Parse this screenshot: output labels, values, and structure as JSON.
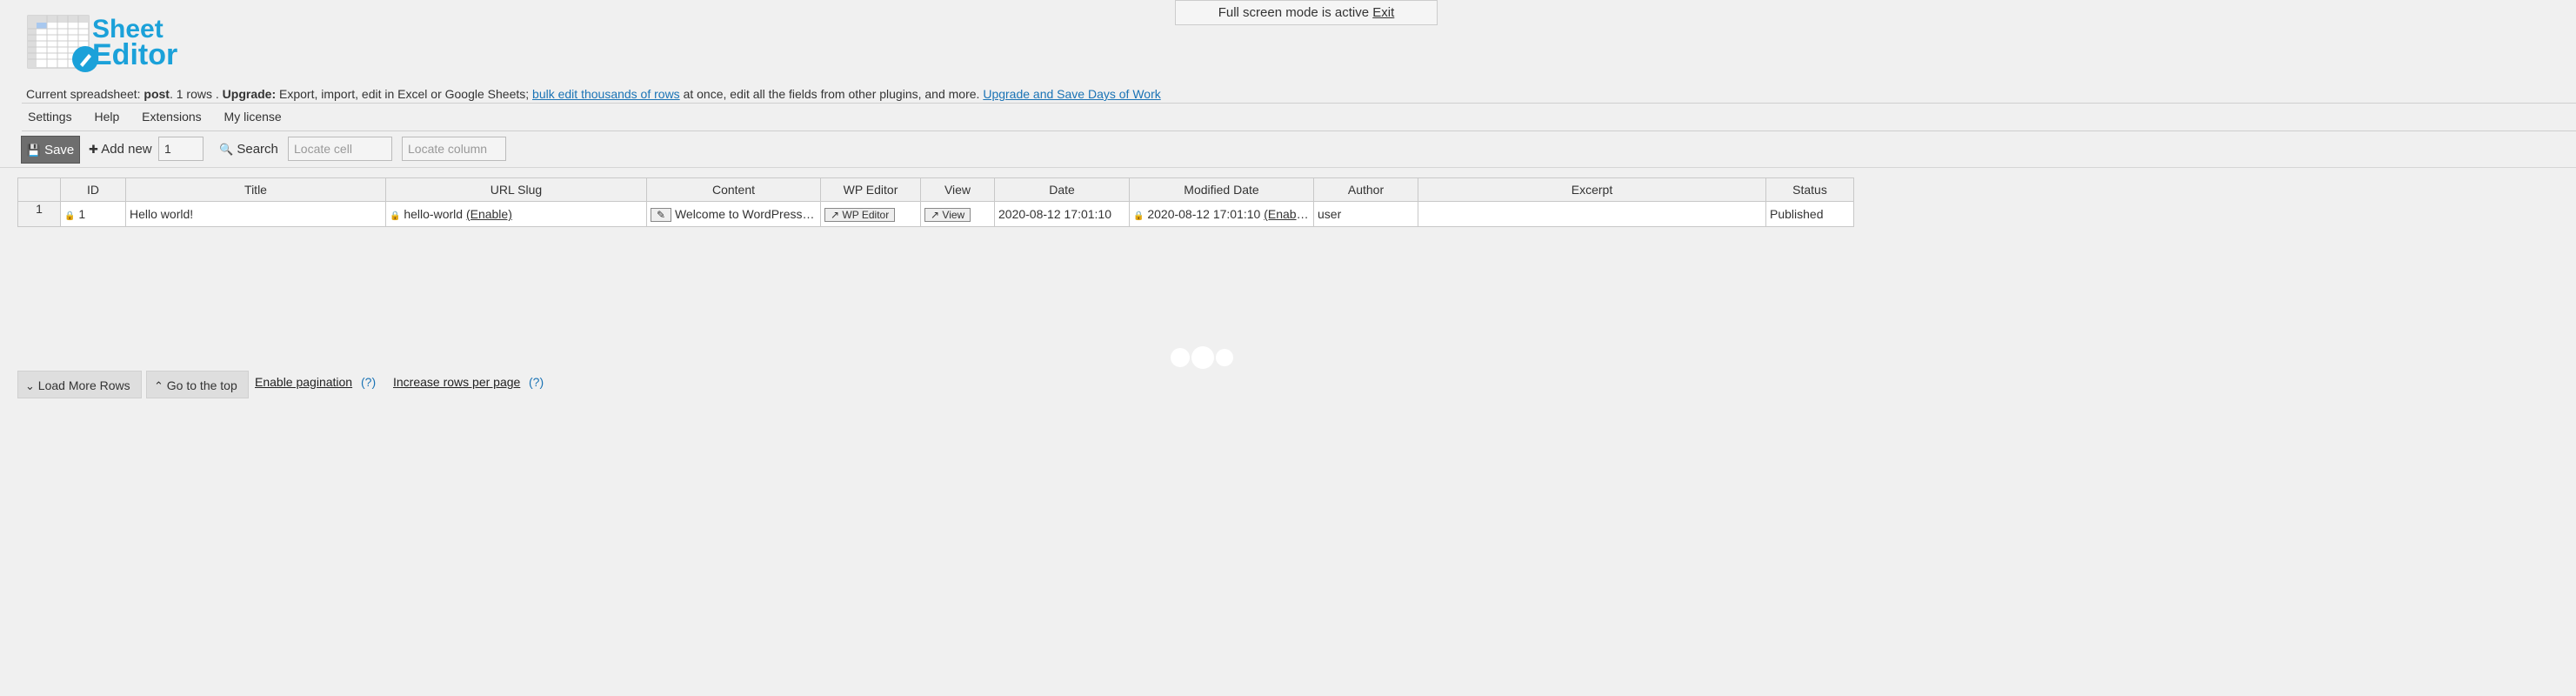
{
  "fullscreen": {
    "text": "Full screen mode is active",
    "exit": "Exit"
  },
  "logo": {
    "line1": "Sheet",
    "line2": "Editor"
  },
  "info": {
    "prefix": "Current spreadsheet: ",
    "post_type": "post",
    "rows": ". 1 rows . ",
    "upgrade_label": "Upgrade:",
    "text1": " Export, import, edit in Excel or Google Sheets; ",
    "link1": "bulk edit thousands of rows",
    "text2": " at once, edit all the fields from other plugins, and more. ",
    "link2": "Upgrade and Save Days of Work"
  },
  "menu": {
    "settings": "Settings",
    "help": "Help",
    "extensions": "Extensions",
    "license": "My license"
  },
  "toolbar": {
    "save": "Save",
    "add_new": "Add new",
    "add_count": "1",
    "search": "Search",
    "locate_cell": "Locate cell",
    "locate_column": "Locate column"
  },
  "table": {
    "headers": [
      "ID",
      "Title",
      "URL Slug",
      "Content",
      "WP Editor",
      "View",
      "Date",
      "Modified Date",
      "Author",
      "Excerpt",
      "Status"
    ],
    "rows": [
      {
        "rownum": "1",
        "id": "1",
        "title": "Hello world!",
        "slug": "hello-world",
        "slug_enable": "(Enable)",
        "content": "Welcome to WordPress. This is your first post.",
        "wp_editor": "WP Editor",
        "view": "View",
        "date": "2020-08-12 17:01:10",
        "modified": "2020-08-12 17:01:10",
        "modified_enable": "(Enable)",
        "author": "user",
        "excerpt": "",
        "status": "Published"
      }
    ]
  },
  "bottom": {
    "load_more": "Load More Rows",
    "go_top": "Go to the top",
    "enable_pagination": "Enable pagination",
    "q1": "(?)",
    "increase_rows": "Increase rows per page",
    "q2": "(?)"
  },
  "colors": {
    "link": "#1a73b5",
    "logo_blue": "#1ba1d9",
    "save_bg": "#6e6e6e"
  }
}
